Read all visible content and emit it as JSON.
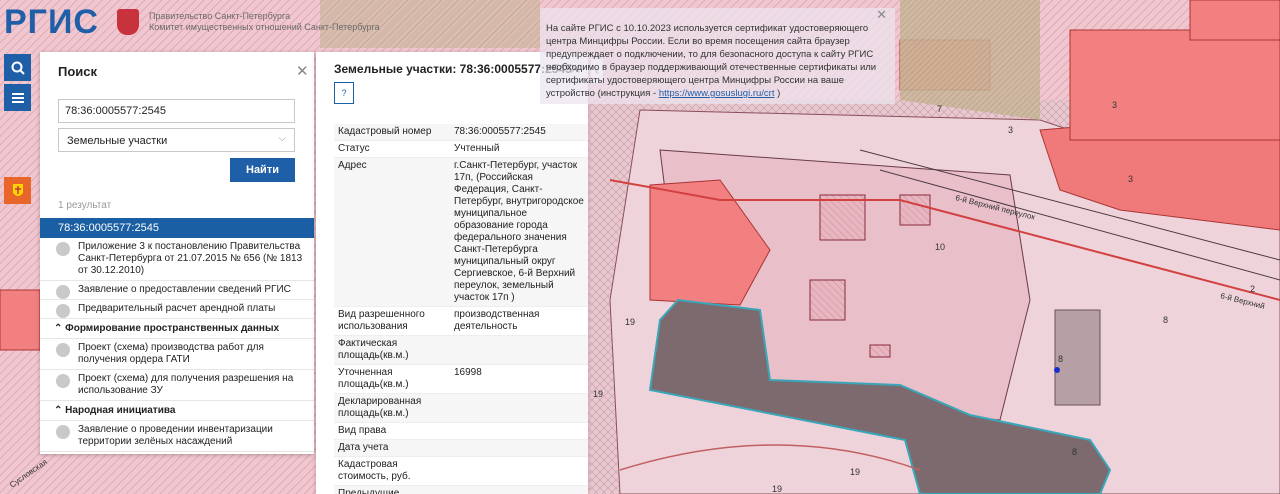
{
  "header": {
    "logo_text": "РГИС",
    "subtitle_line1": "Правительство Санкт-Петербурга",
    "subtitle_line2": "Комитет имущественных отношений Санкт-Петербурга"
  },
  "toolbar": {
    "search_icon": "search-icon",
    "menu_icon": "menu-icon",
    "layers_icon": "city-emblem-icon"
  },
  "search": {
    "title": "Поиск",
    "query": "78:36:0005577:2545",
    "type_value": "Земельные участки",
    "find_label": "Найти",
    "results_count": "1 результат",
    "selected_result": "78:36:0005577:2545"
  },
  "services": {
    "items_top": [
      "Приложение 3 к постановлению Правительства Санкт-Петербурга от 21.07.2015 № 656 (№ 1813 от 30.12.2010)",
      "Заявление о предоставлении сведений РГИС",
      "Предварительный расчет арендной платы"
    ],
    "section2_title": "Формирование пространственных данных",
    "items_section2": [
      "Проект (схема) производства работ для получения ордера ГАТИ",
      "Проект (схема) для получения разрешения на использование ЗУ"
    ],
    "section3_title": "Народная инициатива",
    "items_section3": [
      "Заявление о проведении инвентаризации территории зелёных насаждений"
    ]
  },
  "parcel": {
    "title": "Земельные участки: 78:36:0005577:2545",
    "icon_label": "?",
    "rows": [
      {
        "key": "Кадастровый номер",
        "value": "78:36:0005577:2545"
      },
      {
        "key": "Статус",
        "value": "Учтенный"
      },
      {
        "key": "Адрес",
        "value": "г.Санкт-Петербург, участок 17п, (Российская Федерация, Санкт-Петербург, внутригородское муниципальное образование города федерального значения Санкт-Петербурга муниципальный округ Сергиевское, 6-й Верхний переулок, земельный участок 17п )"
      },
      {
        "key": "Вид разрешенного использования",
        "value": "производственная деятельность"
      },
      {
        "key": "Фактическая площадь(кв.м.)",
        "value": ""
      },
      {
        "key": "Уточненная площадь(кв.м.)",
        "value": "16998"
      },
      {
        "key": "Декларированная площадь(кв.м.)",
        "value": ""
      },
      {
        "key": "Вид права",
        "value": ""
      },
      {
        "key": "Дата учета",
        "value": ""
      },
      {
        "key": "Кадастровая стоимость, руб.",
        "value": ""
      },
      {
        "key": "Предыдущие кадастровые номера",
        "value": ""
      }
    ]
  },
  "notice": {
    "text": "На сайте РГИС с 10.10.2023 используется сертификат удостоверяющего центра Минцифры России. Если во время посещения сайта браузер предупреждает о подключении, то для безопасного доступа к сайту РГИС необходимо в браузер поддерживающий отечественные сертификаты или сертификаты удостоверяющего центра Минцифры России на ваше устройство (инструкция - ",
    "link": "https://www.gosuslugi.ru/crt",
    "tail": " )"
  },
  "map": {
    "street_1": "6-й Верхний переулок",
    "street_2": "6-й Верхний",
    "street_3": "Сусловская",
    "numbers": [
      "7",
      "3",
      "3",
      "3",
      "3",
      "3",
      "10",
      "19",
      "19",
      "19",
      "19",
      "8",
      "8",
      "8",
      "2",
      "3"
    ]
  },
  "colors": {
    "accent": "#1f5fa8",
    "selected": "#1a5fa3",
    "building": "#f28080",
    "parcel_selected": "#3aa6b9"
  }
}
